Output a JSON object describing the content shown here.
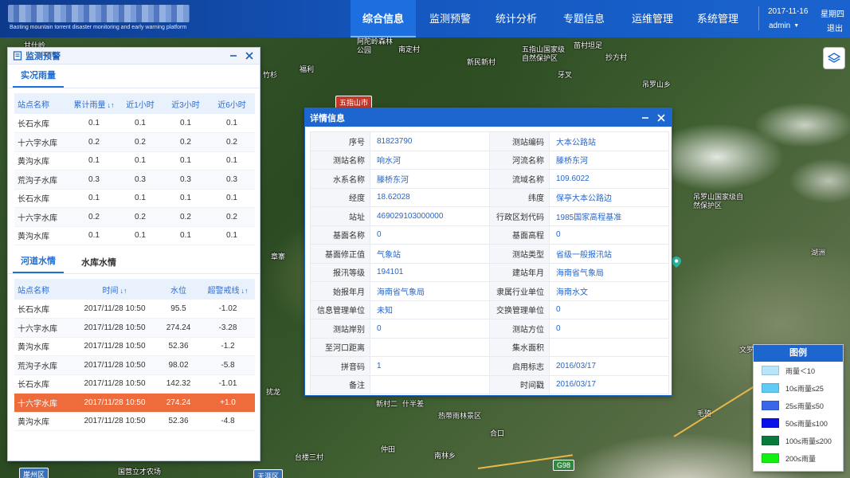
{
  "header": {
    "subtitle": "Baoting mountain torrent disaster monitoring and early warning platform",
    "nav": [
      {
        "label": "综合信息",
        "active": true
      },
      {
        "label": "监测预警",
        "active": false
      },
      {
        "label": "统计分析",
        "active": false
      },
      {
        "label": "专题信息",
        "active": false
      },
      {
        "label": "运维管理",
        "active": false
      },
      {
        "label": "系统管理",
        "active": false
      }
    ],
    "date": "2017-11-16",
    "weekday": "星期四",
    "user": "admin",
    "logout": "退出"
  },
  "map": {
    "labels": [
      "甘什岭",
      "福利",
      "阿陀岭森林公园",
      "南定村",
      "新民新村",
      "五指山国家级自然保护区",
      "苗村坦足",
      "抄方村",
      "吊罗山乡",
      "牙叉",
      "五指山市",
      "竹杉",
      "章寨",
      "吊罗山国家级自然保护区",
      "湖洲",
      "新村二",
      "什半差",
      "热带雨林景区",
      "仲田",
      "南林乡",
      "台楼三村",
      "合口",
      "毛殖",
      "文罗",
      "国营立才农场",
      "扰龙",
      "天涯区",
      "崖州区"
    ],
    "badge": "五指山市",
    "road_label": "G98"
  },
  "left_panel": {
    "title": "监测预警",
    "rain_tab": "实况雨量",
    "rain_columns": [
      "站点名称",
      "累计雨量",
      "近1小时",
      "近3小时",
      "近6小时"
    ],
    "rain_rows": [
      [
        "长石水库",
        "0.1",
        "0.1",
        "0.1",
        "0.1"
      ],
      [
        "十六字水库",
        "0.2",
        "0.2",
        "0.2",
        "0.2"
      ],
      [
        "黄沟水库",
        "0.1",
        "0.1",
        "0.1",
        "0.1"
      ],
      [
        "荒沟子水库",
        "0.3",
        "0.3",
        "0.3",
        "0.3"
      ],
      [
        "长石水库",
        "0.1",
        "0.1",
        "0.1",
        "0.1"
      ],
      [
        "十六字水库",
        "0.2",
        "0.2",
        "0.2",
        "0.2"
      ],
      [
        "黄沟水库",
        "0.1",
        "0.1",
        "0.1",
        "0.1"
      ]
    ],
    "water_tabs": [
      "河道水情",
      "水库水情"
    ],
    "water_columns": [
      "站点名称",
      "时间",
      "水位",
      "超警戒线"
    ],
    "water_rows": [
      [
        "长石水库",
        "2017/11/28  10:50",
        "95.5",
        "-1.02"
      ],
      [
        "十六字水库",
        "2017/11/28  10:50",
        "274.24",
        "-3.28"
      ],
      [
        "黄沟水库",
        "2017/11/28  10:50",
        "52.36",
        "-1.2"
      ],
      [
        "荒沟子水库",
        "2017/11/28  10:50",
        "98.02",
        "-5.8"
      ],
      [
        "长石水库",
        "2017/11/28  10:50",
        "142.32",
        "-1.01"
      ],
      [
        "十六字水库",
        "2017/11/28  10:50",
        "274.24",
        "+1.0"
      ],
      [
        "黄沟水库",
        "2017/11/28  10:50",
        "52.36",
        "-4.8"
      ]
    ],
    "highlight_row": 5
  },
  "detail": {
    "title": "详情信息",
    "rows": [
      [
        [
          "序号",
          "81823790"
        ],
        [
          "测站编码",
          "大本公路站"
        ]
      ],
      [
        [
          "测站名称",
          "响水河"
        ],
        [
          "河流名称",
          "滕桥东河"
        ]
      ],
      [
        [
          "水系名称",
          "滕桥东河"
        ],
        [
          "流域名称",
          "109.6022"
        ]
      ],
      [
        [
          "经度",
          "18.62028"
        ],
        [
          "纬度",
          "保亭大本公路边"
        ]
      ],
      [
        [
          "站址",
          "469029103000000"
        ],
        [
          "行政区划代码",
          "1985国家高程基准"
        ]
      ],
      [
        [
          "基面名称",
          "0"
        ],
        [
          "基面高程",
          "0"
        ]
      ],
      [
        [
          "基面修正值",
          "气象站"
        ],
        [
          "测站类型",
          "省级一般报汛站"
        ]
      ],
      [
        [
          "报汛等级",
          "194101"
        ],
        [
          "建站年月",
          "海南省气象局"
        ]
      ],
      [
        [
          "始报年月",
          "海南省气象局"
        ],
        [
          "隶属行业单位",
          "海南水文"
        ]
      ],
      [
        [
          "信息管理单位",
          "未知"
        ],
        [
          "交换管理单位",
          "0"
        ]
      ],
      [
        [
          "测站岸别",
          "0"
        ],
        [
          "测站方位",
          "0"
        ]
      ],
      [
        [
          "至河口距离",
          ""
        ],
        [
          "集水面积",
          ""
        ]
      ],
      [
        [
          "拼音码",
          "1"
        ],
        [
          "启用标志",
          "2016/03/17"
        ]
      ],
      [
        [
          "备注",
          ""
        ],
        [
          "时间戳",
          "2016/03/17"
        ]
      ]
    ]
  },
  "legend": {
    "title": "图例",
    "items": [
      {
        "label": "雨量＜10",
        "color": "#b7e6fb"
      },
      {
        "label": "10≤雨量≤25",
        "color": "#5fcaf5"
      },
      {
        "label": "25≤雨量≤50",
        "color": "#3a66e8"
      },
      {
        "label": "50≤雨量≤100",
        "color": "#0a10e8"
      },
      {
        "label": "100≤雨量≤200",
        "color": "#0a7a3c"
      },
      {
        "label": "200≤雨量",
        "color": "#12f012"
      }
    ]
  }
}
